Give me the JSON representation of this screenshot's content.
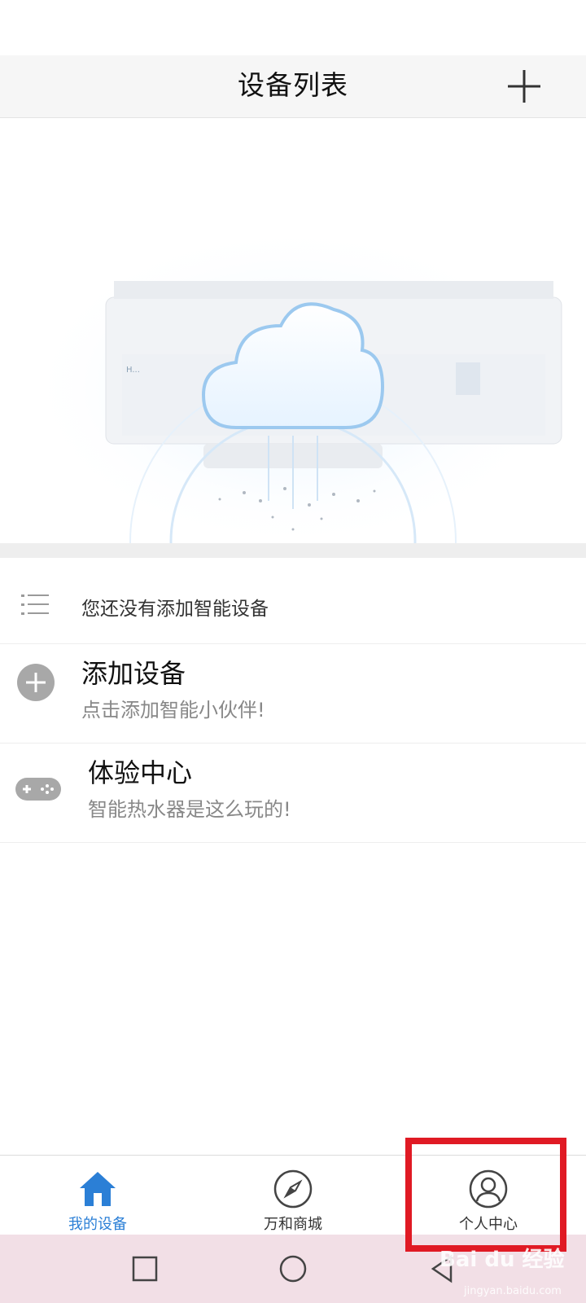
{
  "header": {
    "title": "设备列表",
    "add_icon": "plus-icon"
  },
  "notice": {
    "text": "您还没有添加智能设备",
    "icon": "list-icon"
  },
  "rows": [
    {
      "title": "添加设备",
      "subtitle": "点击添加智能小伙伴!",
      "icon": "plus-circle-icon"
    },
    {
      "title": "体验中心",
      "subtitle": "智能热水器是这么玩的!",
      "icon": "gamepad-icon"
    }
  ],
  "tabs": [
    {
      "label": "我的设备",
      "icon": "home-icon",
      "active": true
    },
    {
      "label": "万和商城",
      "icon": "compass-icon",
      "active": false
    },
    {
      "label": "个人中心",
      "icon": "user-icon",
      "active": false
    }
  ],
  "colors": {
    "accent": "#2b7fd6",
    "highlight": "#e01a24"
  },
  "watermark": {
    "brand": "Bai du 经验",
    "url": "jingyan.baidu.com"
  }
}
